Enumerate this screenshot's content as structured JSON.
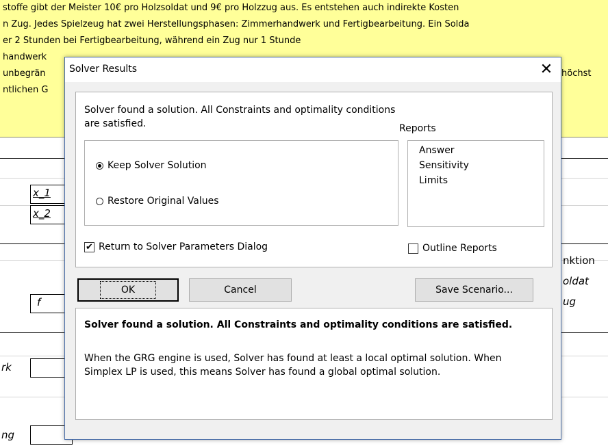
{
  "sheet": {
    "banner_lines": [
      "stoffe gibt der Meister 10€ pro Holzsoldat und 9€ pro Holzzug aus. Es entstehen auch indirekte Kosten",
      "n Zug. Jedes Spielzeug hat zwei Herstellungsphasen: Zimmerhandwerk und Fertigbearbeitung. Ein Solda",
      "er 2 Stunden bei Fertigbearbeitung, während ein Zug nur 1 Stunde",
      "handwerk",
      "unbegrän",
      "ntlichen G"
    ],
    "banner_right_fragment": "höchst",
    "cells": {
      "x1": "x_1",
      "x2": "x_2",
      "f": "f",
      "rk": "rk",
      "ng": "ng"
    },
    "right_texts": {
      "nktion": "nktion",
      "oldat": "oldat",
      "ug": "ug"
    }
  },
  "dialog": {
    "title": "Solver Results",
    "close_glyph": "✕",
    "found_message": "Solver found a solution.  All Constraints and optimality conditions are satisfied.",
    "reports_label": "Reports",
    "radio_keep": "Keep Solver Solution",
    "radio_restore": "Restore Original Values",
    "reports": [
      "Answer",
      "Sensitivity",
      "Limits"
    ],
    "checkbox_return": "Return to Solver Parameters Dialog",
    "checkbox_outline": "Outline Reports",
    "checkbox_return_checked": true,
    "checkbox_outline_checked": false,
    "buttons": {
      "ok": "OK",
      "cancel": "Cancel",
      "save_scenario": "Save Scenario..."
    },
    "message_heading": "Solver found a solution.  All Constraints and optimality conditions are satisfied.",
    "message_body": "When the GRG engine is used, Solver has found at least a local optimal solution. When Simplex LP is used, this means Solver has found a global optimal solution."
  },
  "colors": {
    "banner": "#ffff99",
    "dialog_bg": "#f0f0f0",
    "dialog_border": "#4a6da8"
  }
}
